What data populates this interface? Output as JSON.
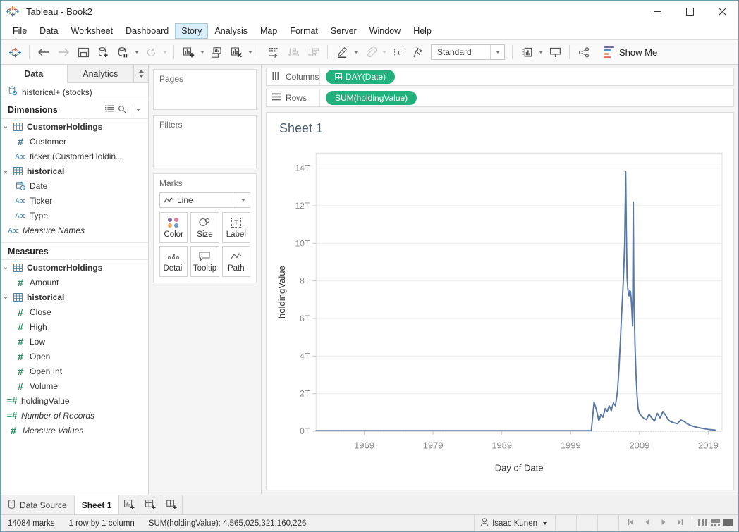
{
  "window": {
    "title": "Tableau - Book2",
    "app_icon": "tableau-logo-icon",
    "minimize": "minimize-icon",
    "maximize": "maximize-icon",
    "close": "close-icon"
  },
  "menubar": {
    "items": [
      {
        "label": "File",
        "accel": "F",
        "active": false
      },
      {
        "label": "Data",
        "accel": "D",
        "active": false
      },
      {
        "label": "Worksheet",
        "accel": "W",
        "active": false
      },
      {
        "label": "Dashboard",
        "accel": "B",
        "active": false
      },
      {
        "label": "Story",
        "accel": "S",
        "active": true
      },
      {
        "label": "Analysis",
        "accel": "A",
        "active": false
      },
      {
        "label": "Map",
        "accel": "M",
        "active": false
      },
      {
        "label": "Format",
        "accel": "O",
        "active": false
      },
      {
        "label": "Server",
        "accel": "R",
        "active": false
      },
      {
        "label": "Window",
        "accel": "N",
        "active": false
      },
      {
        "label": "Help",
        "accel": "H",
        "active": false
      }
    ]
  },
  "toolbar": {
    "fit_value": "Standard",
    "show_me_label": "Show Me",
    "buttons": [
      "tableau-logo-icon",
      "back-icon",
      "forward-icon",
      "save-icon",
      "new-data-source-icon",
      "pause-auto-update-icon",
      "refresh-data-source-icon",
      "new-worksheet-icon",
      "duplicate-sheet-icon",
      "clear-sheet-icon",
      "swap-rows-cols-icon",
      "sort-ascending-icon",
      "sort-descending-icon",
      "highlight-icon",
      "fix-axes-icon",
      "show-labels-icon",
      "presentation-mode-icon",
      "share-icon"
    ]
  },
  "data_pane": {
    "tabs": [
      {
        "label": "Data",
        "selected": true
      },
      {
        "label": "Analytics",
        "selected": false
      }
    ],
    "data_source": {
      "label": "historical+ (stocks)",
      "icon": "database-connected-icon"
    },
    "dimensions": {
      "title": "Dimensions",
      "tools": [
        "grid-view-icon",
        "search-icon",
        "chevron-down-icon"
      ],
      "fields": [
        {
          "label": "CustomerHoldings",
          "icon": "table-icon",
          "kind": "table",
          "expanded": true
        },
        {
          "label": "Customer",
          "icon": "number-icon-blue",
          "kind": "number",
          "indent": 1
        },
        {
          "label": "ticker (CustomerHoldin...",
          "icon": "abc-icon",
          "kind": "string",
          "indent": 1
        },
        {
          "label": "historical",
          "icon": "table-icon",
          "kind": "table",
          "expanded": true
        },
        {
          "label": "Date",
          "icon": "date-time-icon",
          "kind": "date",
          "indent": 1
        },
        {
          "label": "Ticker",
          "icon": "abc-icon",
          "kind": "string",
          "indent": 1
        },
        {
          "label": "Type",
          "icon": "abc-icon",
          "kind": "string",
          "indent": 1
        },
        {
          "label": "Measure Names",
          "icon": "abc-icon",
          "kind": "string",
          "italic": true
        }
      ]
    },
    "measures": {
      "title": "Measures",
      "fields": [
        {
          "label": "CustomerHoldings",
          "icon": "table-icon",
          "kind": "table",
          "expanded": true
        },
        {
          "label": "Amount",
          "icon": "number-icon-green",
          "kind": "number",
          "indent": 1
        },
        {
          "label": "historical",
          "icon": "table-icon",
          "kind": "table",
          "expanded": true
        },
        {
          "label": "Close",
          "icon": "number-icon-green",
          "kind": "number",
          "indent": 1
        },
        {
          "label": "High",
          "icon": "number-icon-green",
          "kind": "number",
          "indent": 1
        },
        {
          "label": "Low",
          "icon": "number-icon-green",
          "kind": "number",
          "indent": 1
        },
        {
          "label": "Open",
          "icon": "number-icon-green",
          "kind": "number",
          "indent": 1
        },
        {
          "label": "Open Int",
          "icon": "number-icon-green",
          "kind": "number",
          "indent": 1
        },
        {
          "label": "Volume",
          "icon": "number-icon-green",
          "kind": "number",
          "indent": 1
        },
        {
          "label": "holdingValue",
          "icon": "calculated-number-icon",
          "kind": "calc"
        },
        {
          "label": "Number of Records",
          "icon": "calculated-number-icon",
          "kind": "calc",
          "italic": true
        },
        {
          "label": "Measure Values",
          "icon": "number-icon-green",
          "kind": "number",
          "italic": true
        }
      ]
    }
  },
  "cards": {
    "pages": {
      "title": "Pages"
    },
    "filters": {
      "title": "Filters"
    },
    "marks": {
      "title": "Marks",
      "mark_type": "Line",
      "mark_type_icon": "line-mark-icon",
      "buttons": [
        {
          "label": "Color",
          "icon": "color-dots-icon"
        },
        {
          "label": "Size",
          "icon": "size-icon"
        },
        {
          "label": "Label",
          "icon": "label-text-icon"
        },
        {
          "label": "Detail",
          "icon": "detail-dots-icon"
        },
        {
          "label": "Tooltip",
          "icon": "tooltip-icon"
        },
        {
          "label": "Path",
          "icon": "path-line-icon"
        }
      ]
    }
  },
  "shelves": {
    "columns": {
      "label": "Columns",
      "icon": "columns-icon",
      "pills": [
        {
          "text": "DAY(Date)",
          "has_expand": true
        }
      ]
    },
    "rows": {
      "label": "Rows",
      "icon": "rows-icon",
      "pills": [
        {
          "text": "SUM(holdingValue)",
          "has_expand": false
        }
      ]
    }
  },
  "sheet": {
    "title": "Sheet 1"
  },
  "chart_data": {
    "type": "line",
    "title": "Sheet 1",
    "xlabel": "Day of Date",
    "ylabel": "holdingValue",
    "xticks": [
      "1969",
      "1979",
      "1989",
      "1999",
      "2009",
      "2019"
    ],
    "xtick_values": [
      1969,
      1979,
      1989,
      1999,
      2009,
      2019
    ],
    "yticks": [
      "0T",
      "2T",
      "4T",
      "6T",
      "8T",
      "10T",
      "12T",
      "14T"
    ],
    "ytick_values": [
      0,
      2,
      4,
      6,
      8,
      10,
      12,
      14
    ],
    "ylim": [
      0,
      14.8
    ],
    "xlim": [
      1962,
      2021
    ],
    "grid": true,
    "line_color": "#5778a4",
    "series": [
      {
        "name": "SUM(holdingValue)",
        "x": [
          1962,
          1965,
          1968,
          1971,
          1974,
          1977,
          1980,
          1983,
          1986,
          1989,
          1992,
          1995,
          1998,
          2000,
          2001,
          2002,
          2002.4,
          2002.8,
          2003.1,
          2003.4,
          2003.7,
          2004.0,
          2004.3,
          2004.6,
          2004.9,
          2005.2,
          2005.5,
          2005.8,
          2006.0,
          2006.2,
          2006.4,
          2006.55,
          2006.7,
          2006.85,
          2007.0,
          2007.1,
          2007.2,
          2007.3,
          2007.4,
          2007.5,
          2007.6,
          2007.7,
          2007.8,
          2007.9,
          2008.0,
          2008.1,
          2008.2,
          2008.35,
          2008.5,
          2008.65,
          2008.8,
          2009.0,
          2009.3,
          2009.6,
          2010.0,
          2010.4,
          2010.8,
          2011.2,
          2011.6,
          2012.0,
          2012.4,
          2012.8,
          2013.2,
          2013.6,
          2014.0,
          2014.5,
          2015.0,
          2015.5,
          2016.0,
          2016.5,
          2017.0,
          2017.5,
          2018.0,
          2018.5,
          2019.0,
          2019.5,
          2020.0
        ],
        "y": [
          0.03,
          0.03,
          0.03,
          0.03,
          0.03,
          0.03,
          0.03,
          0.03,
          0.03,
          0.03,
          0.03,
          0.03,
          0.03,
          0.03,
          0.03,
          0.03,
          1.55,
          1.05,
          0.55,
          0.9,
          0.75,
          1.2,
          1.05,
          1.35,
          1.1,
          1.5,
          1.35,
          2.1,
          3.2,
          4.6,
          6.2,
          7.2,
          8.4,
          10.0,
          13.8,
          10.5,
          8.2,
          7.6,
          7.3,
          7.2,
          7.5,
          7.4,
          7.0,
          6.4,
          5.6,
          12.2,
          7.0,
          4.6,
          3.0,
          1.9,
          1.2,
          0.95,
          0.8,
          0.7,
          0.62,
          0.9,
          0.7,
          0.55,
          0.95,
          0.7,
          1.05,
          0.85,
          0.6,
          0.5,
          0.45,
          0.4,
          0.6,
          0.52,
          0.38,
          0.3,
          0.24,
          0.2,
          0.16,
          0.13,
          0.1,
          0.08,
          0.06
        ]
      }
    ]
  },
  "tabstrip": {
    "data_source": {
      "label": "Data Source",
      "icon": "data-source-icon"
    },
    "sheets": [
      {
        "label": "Sheet 1",
        "selected": true
      }
    ],
    "new_buttons": [
      "new-worksheet-icon",
      "new-dashboard-icon",
      "new-story-icon"
    ]
  },
  "statusbar": {
    "marks": "14084 marks",
    "rows_cols": "1 row by 1 column",
    "aggregate": "SUM(holdingValue): 4,565,025,321,160,226",
    "user": "Isaac Kunen",
    "user_icon": "person-icon",
    "nav": [
      "first-page-icon",
      "previous-page-icon",
      "next-page-icon",
      "last-page-icon"
    ],
    "view_modes": [
      "grid-view-icon",
      "split-view-icon",
      "single-view-icon"
    ]
  },
  "colors": {
    "pill_green": "#22b07d",
    "line_blue": "#5778a4",
    "accent_blue": "#6a9fb5",
    "menu_active_bg": "#ddeefb"
  }
}
